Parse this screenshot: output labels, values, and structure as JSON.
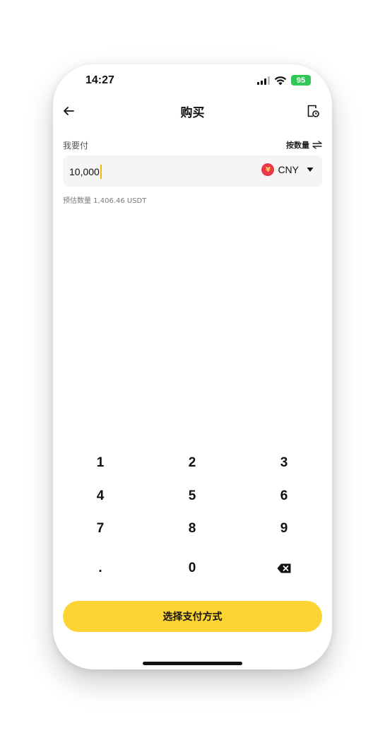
{
  "status_bar": {
    "time": "14:27",
    "battery": "95"
  },
  "nav": {
    "title": "购买",
    "back_icon": "arrow-left-icon",
    "history_icon": "order-history-icon"
  },
  "form": {
    "pay_label": "我要付",
    "toggle_label": "按数量",
    "amount_value": "10,000",
    "currency_symbol": "¥",
    "currency_code": "CNY",
    "estimate_text": "预估数量 1,406.46 USDT"
  },
  "keypad": {
    "keys": [
      "1",
      "2",
      "3",
      "4",
      "5",
      "6",
      "7",
      "8",
      "9",
      ".",
      "0"
    ],
    "backspace_icon": "backspace-icon"
  },
  "cta": {
    "label": "选择支付方式"
  },
  "colors": {
    "accent": "#fcd535",
    "caret": "#f0b90b",
    "battery": "#32c759",
    "cny_badge": "#e8364a"
  }
}
